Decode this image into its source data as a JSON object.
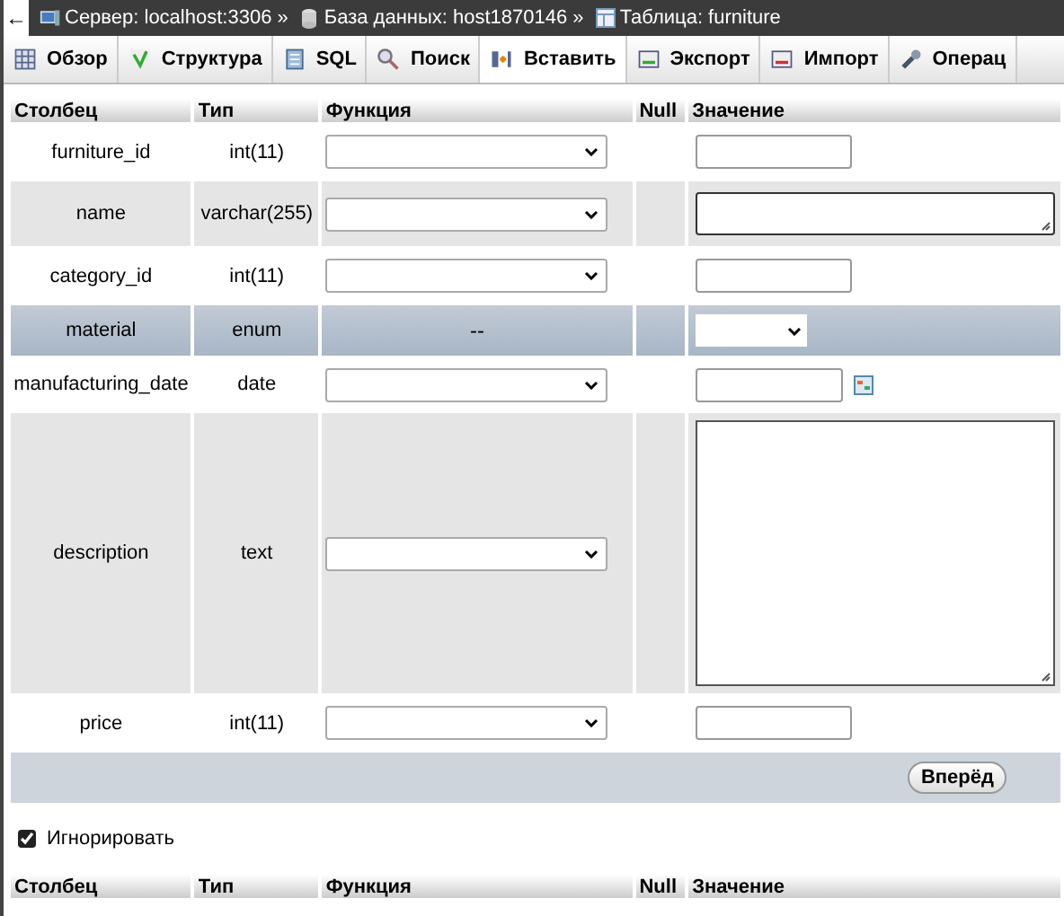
{
  "back_button": "←",
  "breadcrumb": [
    {
      "kind": "server",
      "text": "Сервер: localhost:3306 »"
    },
    {
      "kind": "database",
      "text": "База данных: host1870146 »"
    },
    {
      "kind": "table",
      "text": "Таблица: furniture"
    }
  ],
  "tabs": [
    {
      "label": "Обзор",
      "kind": "grid",
      "selected": false
    },
    {
      "label": "Структура",
      "kind": "structure",
      "selected": false
    },
    {
      "label": "SQL",
      "kind": "sql",
      "selected": false
    },
    {
      "label": "Поиск",
      "kind": "search",
      "selected": false
    },
    {
      "label": "Вставить",
      "kind": "insert",
      "selected": true
    },
    {
      "label": "Экспорт",
      "kind": "export",
      "selected": false
    },
    {
      "label": "Импорт",
      "kind": "import",
      "selected": false
    },
    {
      "label": "Операц",
      "kind": "wrench",
      "selected": false
    }
  ],
  "columns": [
    "Столбец",
    "Тип",
    "Функция",
    "Null",
    "Значение"
  ],
  "rows": [
    {
      "name": "furniture_id",
      "type": "int(11)",
      "kind": "input",
      "highlighted": false
    },
    {
      "name": "name",
      "type": "varchar(255)",
      "kind": "textarea",
      "highlighted": false
    },
    {
      "name": "category_id",
      "type": "int(11)",
      "kind": "input",
      "highlighted": false
    },
    {
      "name": "material",
      "type": "enum",
      "kind": "enum",
      "function": "--",
      "highlighted": true
    },
    {
      "name": "manufacturing_date",
      "type": "date",
      "kind": "date",
      "highlighted": false
    },
    {
      "name": "description",
      "type": "text",
      "kind": "bigtext",
      "highlighted": false
    },
    {
      "name": "price",
      "type": "int(11)",
      "kind": "input",
      "highlighted": false
    }
  ],
  "submit_button": "Вперёд",
  "ignore": {
    "label": "Игнорировать",
    "checked": true
  },
  "columns_2": [
    "Столбец",
    "Тип",
    "Функция",
    "Null",
    "Значение"
  ]
}
